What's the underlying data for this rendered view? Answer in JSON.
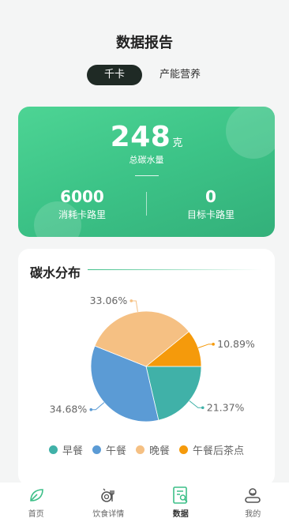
{
  "page": {
    "title": "数据报告"
  },
  "tabs": [
    {
      "label": "千卡",
      "active": true
    },
    {
      "label": "产能营养",
      "active": false
    }
  ],
  "summary": {
    "total_value": "248",
    "total_unit": "克",
    "total_label": "总碳水量",
    "left_value": "6000",
    "left_label": "消耗卡路里",
    "right_value": "0",
    "right_label": "目标卡路里"
  },
  "chart_section": {
    "title": "碳水分布"
  },
  "chart_data": {
    "type": "pie",
    "slices": [
      {
        "name": "早餐",
        "value": 21.37,
        "label": "21.37%",
        "color": "#40b1a8"
      },
      {
        "name": "午餐",
        "value": 34.68,
        "label": "34.68%",
        "color": "#5b9bd5"
      },
      {
        "name": "晚餐",
        "value": 33.06,
        "label": "33.06%",
        "color": "#f5c083"
      },
      {
        "name": "午餐后茶点",
        "value": 10.89,
        "label": "10.89%",
        "color": "#f59a0b"
      }
    ],
    "legend_position": "bottom"
  },
  "tabbar": [
    {
      "label": "首页",
      "icon": "leaf-icon",
      "active": false
    },
    {
      "label": "饮食详情",
      "icon": "meal-icon",
      "active": false
    },
    {
      "label": "数据",
      "icon": "report-icon",
      "active": true
    },
    {
      "label": "我的",
      "icon": "user-icon",
      "active": false
    }
  ]
}
